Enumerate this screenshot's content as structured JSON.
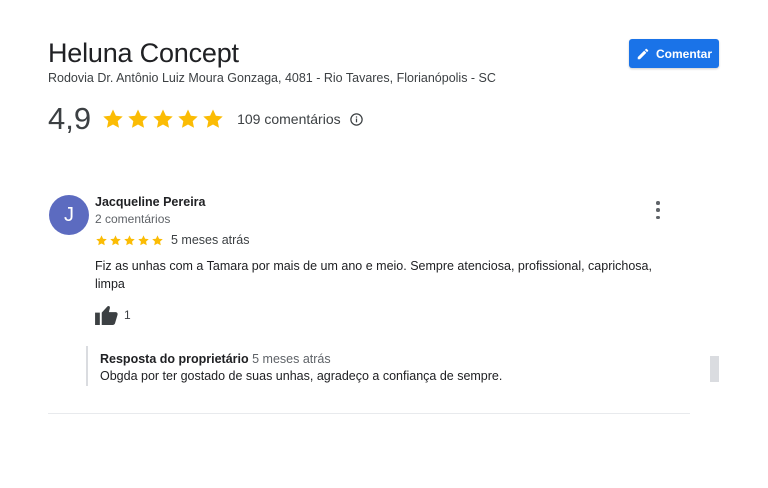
{
  "place": {
    "name": "Heluna Concept",
    "address": "Rodovia Dr. Antônio Luiz Moura Gonzaga, 4081 - Rio Tavares, Florianópolis - SC"
  },
  "actions": {
    "comment_label": "Comentar"
  },
  "summary": {
    "rating": "4,9",
    "stars": 5,
    "review_count": "109 comentários"
  },
  "review": {
    "avatar_letter": "J",
    "author": "Jacqueline Pereira",
    "author_reviews": "2 comentários",
    "stars": 5,
    "time_ago": "5 meses atrás",
    "text": "Fiz as unhas com a Tamara por mais de um ano e meio. Sempre atenciosa, profissional, caprichosa, limpa",
    "likes": "1",
    "owner_response": {
      "label": "Resposta do proprietário",
      "time_ago": "5 meses atrás",
      "text": "Obgda por ter gostado de suas unhas, agradeço a confiança de sempre."
    }
  },
  "colors": {
    "accent": "#1a73e8",
    "star": "#fbbc04",
    "avatar": "#5c6bc0"
  },
  "icons": [
    "pencil-icon",
    "star-icon",
    "info-icon",
    "more-vert-icon",
    "thumb-up-icon"
  ]
}
